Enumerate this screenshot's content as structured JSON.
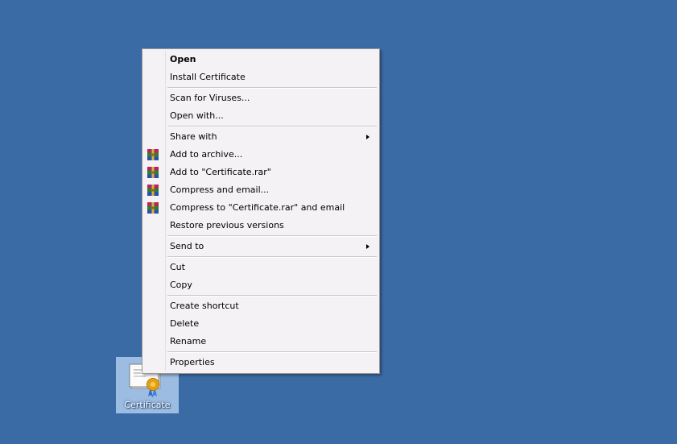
{
  "desktop": {
    "background_color": "#3a6ba5",
    "icon": {
      "label": "Certificate",
      "icon_name": "certificate-icon"
    }
  },
  "context_menu": {
    "items": [
      {
        "label": "Open",
        "bold": true
      },
      {
        "label": "Install Certificate"
      },
      {
        "label": "Scan for Viruses..."
      },
      {
        "label": "Open with..."
      },
      {
        "label": "Share with",
        "submenu": true
      },
      {
        "label": "Add to archive...",
        "icon": "winrar-icon"
      },
      {
        "label": "Add to \"Certificate.rar\"",
        "icon": "winrar-icon"
      },
      {
        "label": "Compress and email...",
        "icon": "winrar-icon"
      },
      {
        "label": "Compress to \"Certificate.rar\" and email",
        "icon": "winrar-icon"
      },
      {
        "label": "Restore previous versions"
      },
      {
        "label": "Send to",
        "submenu": true
      },
      {
        "label": "Cut"
      },
      {
        "label": "Copy"
      },
      {
        "label": "Create shortcut"
      },
      {
        "label": "Delete"
      },
      {
        "label": "Rename"
      },
      {
        "label": "Properties"
      }
    ]
  }
}
